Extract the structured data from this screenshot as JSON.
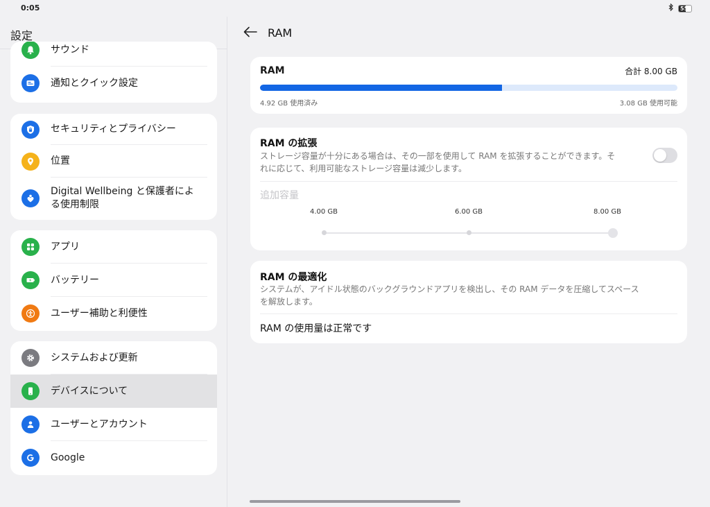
{
  "status_bar": {
    "time": "0:05",
    "battery": "55"
  },
  "left": {
    "title": "設定",
    "groups": [
      {
        "items": [
          {
            "label": "サウンド",
            "icon": "bell-icon",
            "color": "#29b14b"
          },
          {
            "label": "通知とクイック設定",
            "icon": "notification-icon",
            "color": "#1c6fe6"
          }
        ]
      },
      {
        "items": [
          {
            "label": "セキュリティとプライバシー",
            "icon": "shield-lock-icon",
            "color": "#1c6fe6"
          },
          {
            "label": "位置",
            "icon": "location-pin-icon",
            "color": "#f5b21a"
          },
          {
            "label": "Digital Wellbeing と保護者による使用制限",
            "icon": "heart-person-icon",
            "color": "#1c6fe6"
          }
        ]
      },
      {
        "items": [
          {
            "label": "アプリ",
            "icon": "apps-grid-icon",
            "color": "#29b14b"
          },
          {
            "label": "バッテリー",
            "icon": "battery-icon",
            "color": "#29b14b"
          },
          {
            "label": "ユーザー補助と利便性",
            "icon": "accessibility-icon",
            "color": "#f07a13"
          }
        ]
      },
      {
        "items": [
          {
            "label": "システムおよび更新",
            "icon": "gear-icon",
            "color": "#7b7b80"
          },
          {
            "label": "デバイスについて",
            "icon": "phone-icon",
            "color": "#29b14b",
            "selected": true
          },
          {
            "label": "ユーザーとアカウント",
            "icon": "user-icon",
            "color": "#1c6fe6"
          },
          {
            "label": "Google",
            "icon": "google-icon",
            "color": "#1c6fe6"
          }
        ]
      }
    ]
  },
  "right": {
    "title": "RAM",
    "ram": {
      "label": "RAM",
      "total": "合計 8.00 GB",
      "used_fraction": 0.58,
      "used_label": "4.92 GB 使用済み",
      "available_label": "3.08 GB 使用可能"
    },
    "expansion": {
      "title": "RAM の拡張",
      "description_line1": "ストレージ容量が十分にある場合は、その一部を使用して RAM を拡張することができます。そ",
      "description_line2": "れに応じて、利用可能なストレージ容量は減少します。",
      "toggle_on": false,
      "capacity_label": "追加容量",
      "options": [
        "4.00 GB",
        "6.00 GB",
        "8.00 GB"
      ],
      "selected_index": 2
    },
    "optimization": {
      "title": "RAM の最適化",
      "description_line1": "システムが、アイドル状態のバックグラウンドアプリを検出し、その RAM データを圧縮してスペース",
      "description_line2": "を解放します。",
      "status": "RAM の使用量は正常です"
    }
  }
}
